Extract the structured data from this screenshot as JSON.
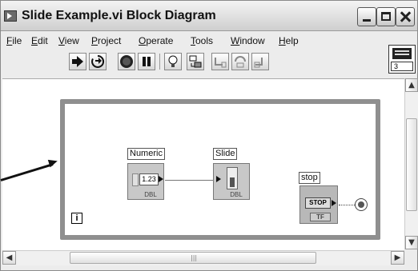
{
  "window": {
    "title": "Slide Example.vi Block Diagram"
  },
  "menu": [
    {
      "label": "File",
      "ul": "F",
      "rest": "ile"
    },
    {
      "label": "Edit",
      "ul": "E",
      "rest": "dit"
    },
    {
      "label": "View",
      "ul": "V",
      "rest": "iew"
    },
    {
      "label": "Project",
      "ul": "P",
      "rest": "roject"
    },
    {
      "label": "Operate",
      "ul": "O",
      "rest": "perate"
    },
    {
      "label": "Tools",
      "ul": "T",
      "rest": "ools"
    },
    {
      "label": "Window",
      "ul": "W",
      "rest": "indow"
    },
    {
      "label": "Help",
      "ul": "H",
      "rest": "elp"
    }
  ],
  "toolbar": {
    "tools": [
      "run-icon",
      "run-continuously-icon",
      "abort-icon",
      "pause-icon",
      "highlight-execution-icon",
      "retain-wire-values-icon",
      "step-into-icon",
      "step-over-icon",
      "step-out-icon"
    ]
  },
  "vi_icon": {
    "number": "3"
  },
  "diagram": {
    "numeric": {
      "label": "Numeric",
      "value": "1.23",
      "type": "DBL"
    },
    "slide": {
      "label": "Slide",
      "type": "DBL"
    },
    "stop": {
      "label": "stop",
      "button_text": "STOP",
      "type": "TF"
    },
    "loop_iteration": "i"
  }
}
